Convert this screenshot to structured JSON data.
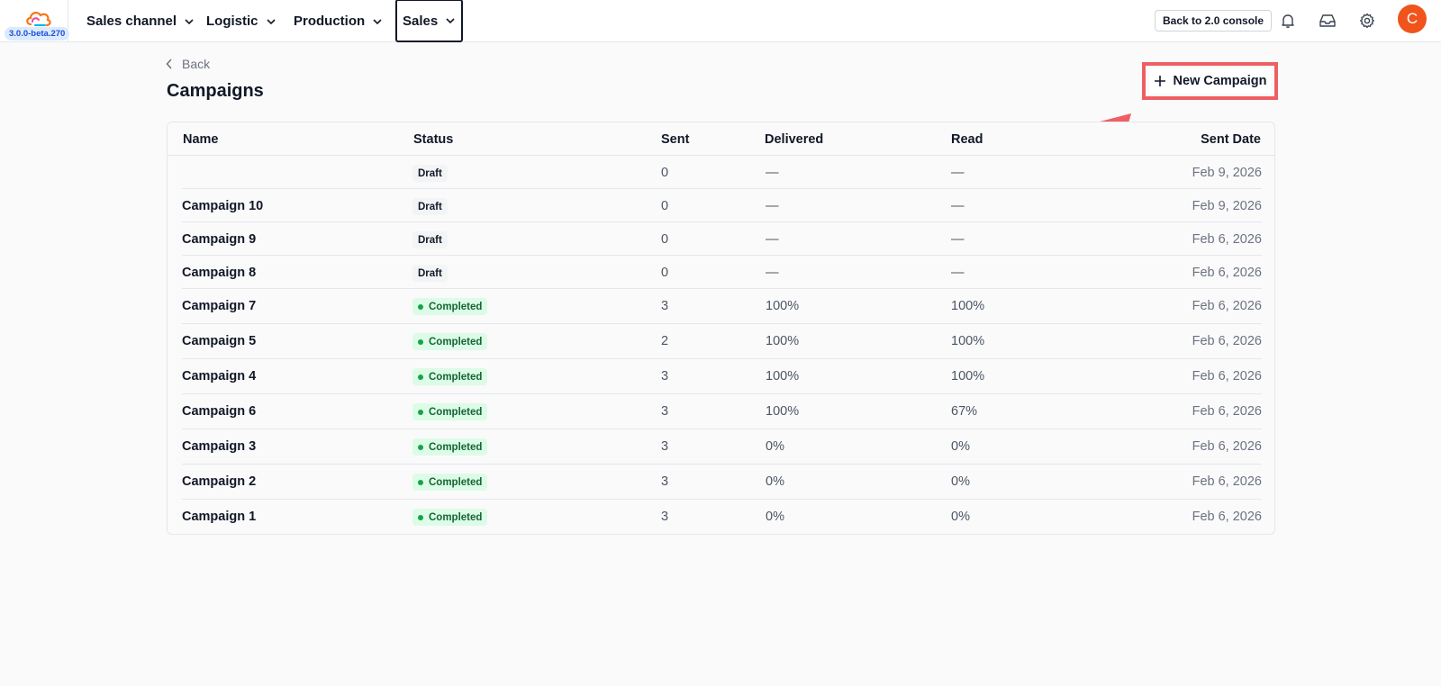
{
  "header": {
    "version": "3.0.0-beta.270",
    "nav": [
      {
        "label": "Sales channel"
      },
      {
        "label": "Logistic"
      },
      {
        "label": "Production"
      },
      {
        "label": "Sales"
      }
    ],
    "console_button": "Back to 2.0 console",
    "avatar_initial": "C",
    "icons": [
      "bell-icon",
      "inbox-icon",
      "gear-icon"
    ]
  },
  "page": {
    "back_label": "Back",
    "title": "Campaigns",
    "new_campaign_label": "New Campaign",
    "annotation_color": "#ee5f62"
  },
  "table": {
    "columns": [
      "Name",
      "Status",
      "Sent",
      "Delivered",
      "Read",
      "Sent Date"
    ],
    "rows": [
      {
        "name": "",
        "status": "Draft",
        "sent": "0",
        "delivered": "—",
        "read": "—",
        "date": "Feb 9, 2026"
      },
      {
        "name": "Campaign 10",
        "status": "Draft",
        "sent": "0",
        "delivered": "—",
        "read": "—",
        "date": "Feb 9, 2026"
      },
      {
        "name": "Campaign 9",
        "status": "Draft",
        "sent": "0",
        "delivered": "—",
        "read": "—",
        "date": "Feb 6, 2026"
      },
      {
        "name": "Campaign 8",
        "status": "Draft",
        "sent": "0",
        "delivered": "—",
        "read": "—",
        "date": "Feb 6, 2026"
      },
      {
        "name": "Campaign 7",
        "status": "Completed",
        "sent": "3",
        "delivered": "100%",
        "read": "100%",
        "date": "Feb 6, 2026"
      },
      {
        "name": "Campaign 5",
        "status": "Completed",
        "sent": "2",
        "delivered": "100%",
        "read": "100%",
        "date": "Feb 6, 2026"
      },
      {
        "name": "Campaign 4",
        "status": "Completed",
        "sent": "3",
        "delivered": "100%",
        "read": "100%",
        "date": "Feb 6, 2026"
      },
      {
        "name": "Campaign 6",
        "status": "Completed",
        "sent": "3",
        "delivered": "100%",
        "read": "67%",
        "date": "Feb 6, 2026"
      },
      {
        "name": "Campaign 3",
        "status": "Completed",
        "sent": "3",
        "delivered": "0%",
        "read": "0%",
        "date": "Feb 6, 2026"
      },
      {
        "name": "Campaign 2",
        "status": "Completed",
        "sent": "3",
        "delivered": "0%",
        "read": "0%",
        "date": "Feb 6, 2026"
      },
      {
        "name": "Campaign 1",
        "status": "Completed",
        "sent": "3",
        "delivered": "0%",
        "read": "0%",
        "date": "Feb 6, 2026"
      }
    ]
  }
}
